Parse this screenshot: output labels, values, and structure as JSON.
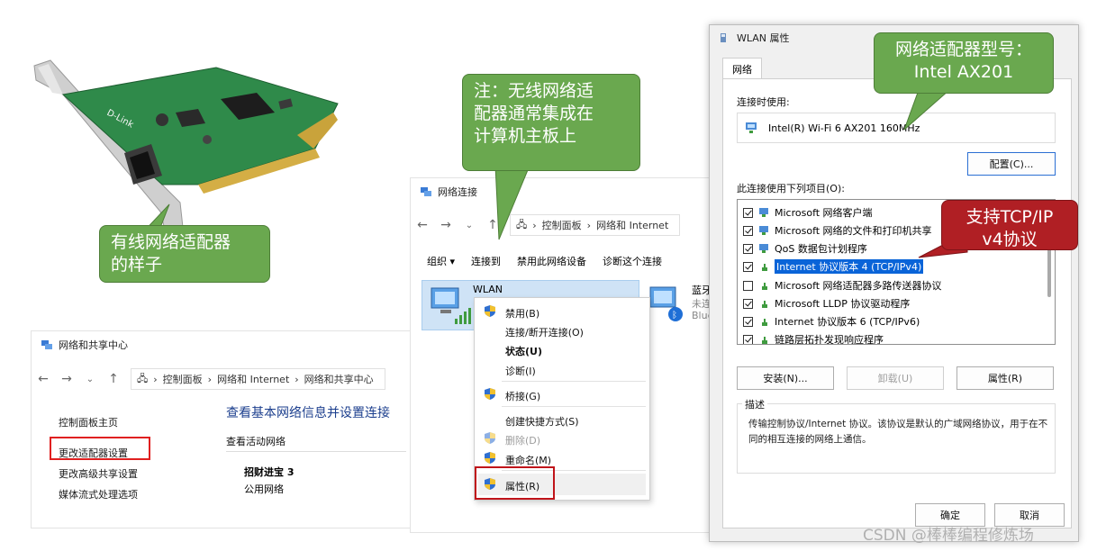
{
  "callouts": {
    "wired": "有线网络适配器\n的样子",
    "wireless": "注：无线网络适\n配器通常集成在\n计算机主板上",
    "model": "网络适配器型号：\nIntel AX201",
    "tcpip": "支持TCP/IP\nv4协议"
  },
  "nic_brand": "D-Link",
  "nsc": {
    "title": "网络和共享中心",
    "breadcrumb": [
      "控制面板",
      "网络和 Internet",
      "网络和共享中心"
    ],
    "heading": "查看基本网络信息并设置连接",
    "active_label": "查看活动网络",
    "sidebar": [
      "控制面板主页",
      "更改适配器设置",
      "更改高级共享设置",
      "媒体流式处理选项"
    ],
    "network_name": "招财进宝 3",
    "network_type": "公用网络"
  },
  "ncw": {
    "title": "网络连接",
    "breadcrumb": [
      "控制面板",
      "网络和 Internet"
    ],
    "commands": [
      "组织 ▾",
      "连接到",
      "禁用此网络设备",
      "诊断这个连接"
    ],
    "wlan_label": "WLAN",
    "bt_label": "蓝牙",
    "bt_line2": "未连",
    "bt_line3": "Blue"
  },
  "context_menu": {
    "items": [
      "禁用(B)",
      "连接/断开连接(O)",
      "状态(U)",
      "诊断(I)",
      "桥接(G)",
      "创建快捷方式(S)",
      "删除(D)",
      "重命名(M)",
      "属性(R)"
    ]
  },
  "dialog": {
    "title": "WLAN 属性",
    "tab": "网络",
    "connect_using_label": "连接时使用:",
    "adapter_name": "Intel(R) Wi-Fi 6 AX201 160MHz",
    "configure_button": "配置(C)...",
    "items_label": "此连接使用下列项目(O):",
    "items": [
      {
        "label": "Microsoft 网络客户端",
        "checked": true
      },
      {
        "label": "Microsoft 网络的文件和打印机共享",
        "checked": true
      },
      {
        "label": "QoS 数据包计划程序",
        "checked": true
      },
      {
        "label": "Internet 协议版本 4 (TCP/IPv4)",
        "checked": true
      },
      {
        "label": "Microsoft 网络适配器多路传送器协议",
        "checked": false
      },
      {
        "label": "Microsoft LLDP 协议驱动程序",
        "checked": true
      },
      {
        "label": "Internet 协议版本 6 (TCP/IPv6)",
        "checked": true
      },
      {
        "label": "链路层拓扑发现响应程序",
        "checked": true
      }
    ],
    "install_button": "安装(N)...",
    "uninstall_button": "卸载(U)",
    "properties_button": "属性(R)",
    "desc_label": "描述",
    "desc_text": "传输控制协议/Internet 协议。该协议是默认的广域网络协议，用于在不同的相互连接的网络上通信。",
    "ok_button": "确定",
    "cancel_button": "取消"
  },
  "watermark": "CSDN @棒棒编程修炼场"
}
